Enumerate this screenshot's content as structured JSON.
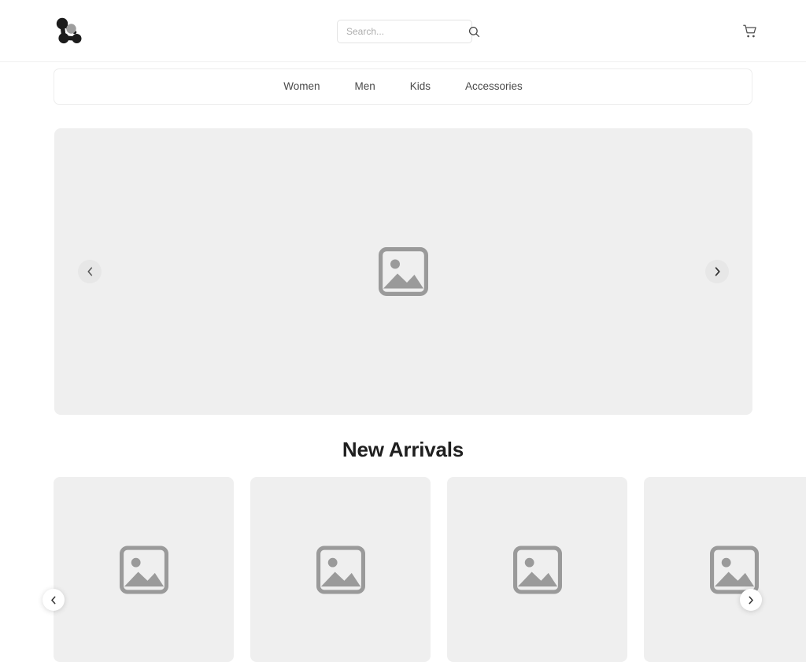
{
  "header": {
    "logo_name": "molecule-logo",
    "search": {
      "placeholder": "Search...",
      "value": "",
      "icon": "search-icon"
    },
    "cart": {
      "icon": "shopping-cart-icon",
      "label": "Cart"
    }
  },
  "nav": {
    "items": [
      {
        "label": "Women"
      },
      {
        "label": "Men"
      },
      {
        "label": "Kids"
      },
      {
        "label": "Accessories"
      }
    ]
  },
  "hero": {
    "placeholder_icon": "image-placeholder-icon",
    "prev_icon": "chevron-left-icon",
    "next_icon": "chevron-right-icon"
  },
  "new_arrivals": {
    "title": "New Arrivals",
    "prev_icon": "chevron-left-icon",
    "next_icon": "chevron-right-icon",
    "cards": [
      {
        "placeholder_icon": "image-placeholder-icon"
      },
      {
        "placeholder_icon": "image-placeholder-icon"
      },
      {
        "placeholder_icon": "image-placeholder-icon"
      },
      {
        "placeholder_icon": "image-placeholder-icon"
      },
      {
        "placeholder_icon": "image-placeholder-icon"
      }
    ]
  },
  "colors": {
    "page_background": "#ffffff",
    "panel_gray": "#efefef",
    "placeholder_icon": "#9a9a9a",
    "text_primary": "#1f1f1f",
    "text_nav": "#4a4a4a",
    "placeholder_text": "#adadad",
    "border": "#ededed",
    "logo_dark": "#1c1c1c",
    "logo_gray": "#9e9e9e"
  }
}
